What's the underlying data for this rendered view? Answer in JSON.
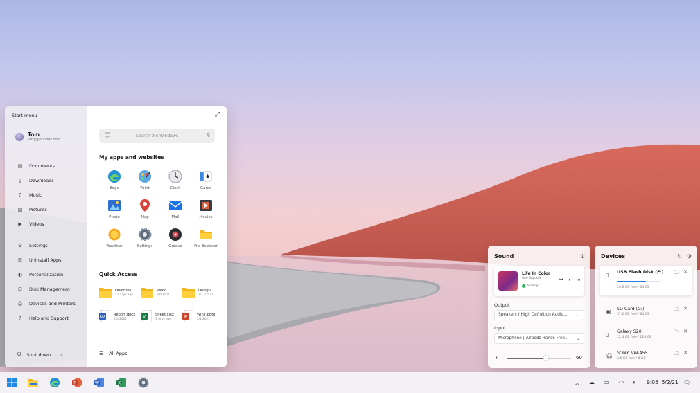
{
  "start_menu": {
    "title": "Start menu",
    "user": {
      "name": "Tom",
      "email": "Jerry@outlook.com"
    },
    "nav_top": [
      "Documents",
      "Downloads",
      "Music",
      "Pictures",
      "Videos"
    ],
    "nav_bottom": [
      "Settings",
      "Uninstall Apps",
      "Personalization",
      "Disk Management",
      "Devices and Printers",
      "Help and Support"
    ],
    "shutdown_label": "Shut down",
    "search_placeholder": "Search the Windows",
    "apps_title": "My apps and websites",
    "apps": [
      "Edge",
      "Paint",
      "Clock",
      "Game",
      "Photo",
      "Map",
      "Mail",
      "Movies",
      "Weather",
      "Settings",
      "Groove",
      "File Explorer"
    ],
    "quick_access_title": "Quick Access",
    "quick_access": [
      {
        "name": "Favorites",
        "date": "12 days ago",
        "icon": "folder-icon"
      },
      {
        "name": "Work",
        "date": "3/6/2021",
        "icon": "folder-icon"
      },
      {
        "name": "Design",
        "date": "3/12/2021",
        "icon": "folder-icon"
      },
      {
        "name": "Report.docx",
        "date": "2/4/2021",
        "icon": "word-doc-icon"
      },
      {
        "name": "Sheet.xlsx",
        "date": "3 days ago",
        "icon": "excel-doc-icon"
      },
      {
        "name": "Win7.pptx",
        "date": "3/1/2021",
        "icon": "ppt-doc-icon"
      }
    ],
    "all_apps_label": "All Apps"
  },
  "sound": {
    "title": "Sound",
    "song": "Life In Color",
    "artist": "One Republic",
    "source": "Spotify",
    "output_label": "Output",
    "output_value": "Speakers ( High Definition Audio...",
    "input_label": "Input",
    "input_value": "Microphone ( Airpods Hands-Free...",
    "volume": "60"
  },
  "devices": {
    "title": "Devices",
    "items": [
      {
        "name": "USB Flash Disk (F:)",
        "storage": "20.8 GB free  /  64 GB",
        "used_fraction": 0.68
      },
      {
        "name": "SD Card (G:)",
        "storage": "37.2 GB free  /  64 GB"
      },
      {
        "name": "Galaxy S20",
        "storage": "12.4 GB free  /  128 GB"
      },
      {
        "name": "SONY NW-A55",
        "storage": "3.6 GB free  /  8 GB"
      }
    ]
  },
  "taskbar": {
    "time": "9:05",
    "date": "5/2/21"
  },
  "colors": {
    "accent": "#2f7ad8",
    "spotify": "#1db954"
  }
}
